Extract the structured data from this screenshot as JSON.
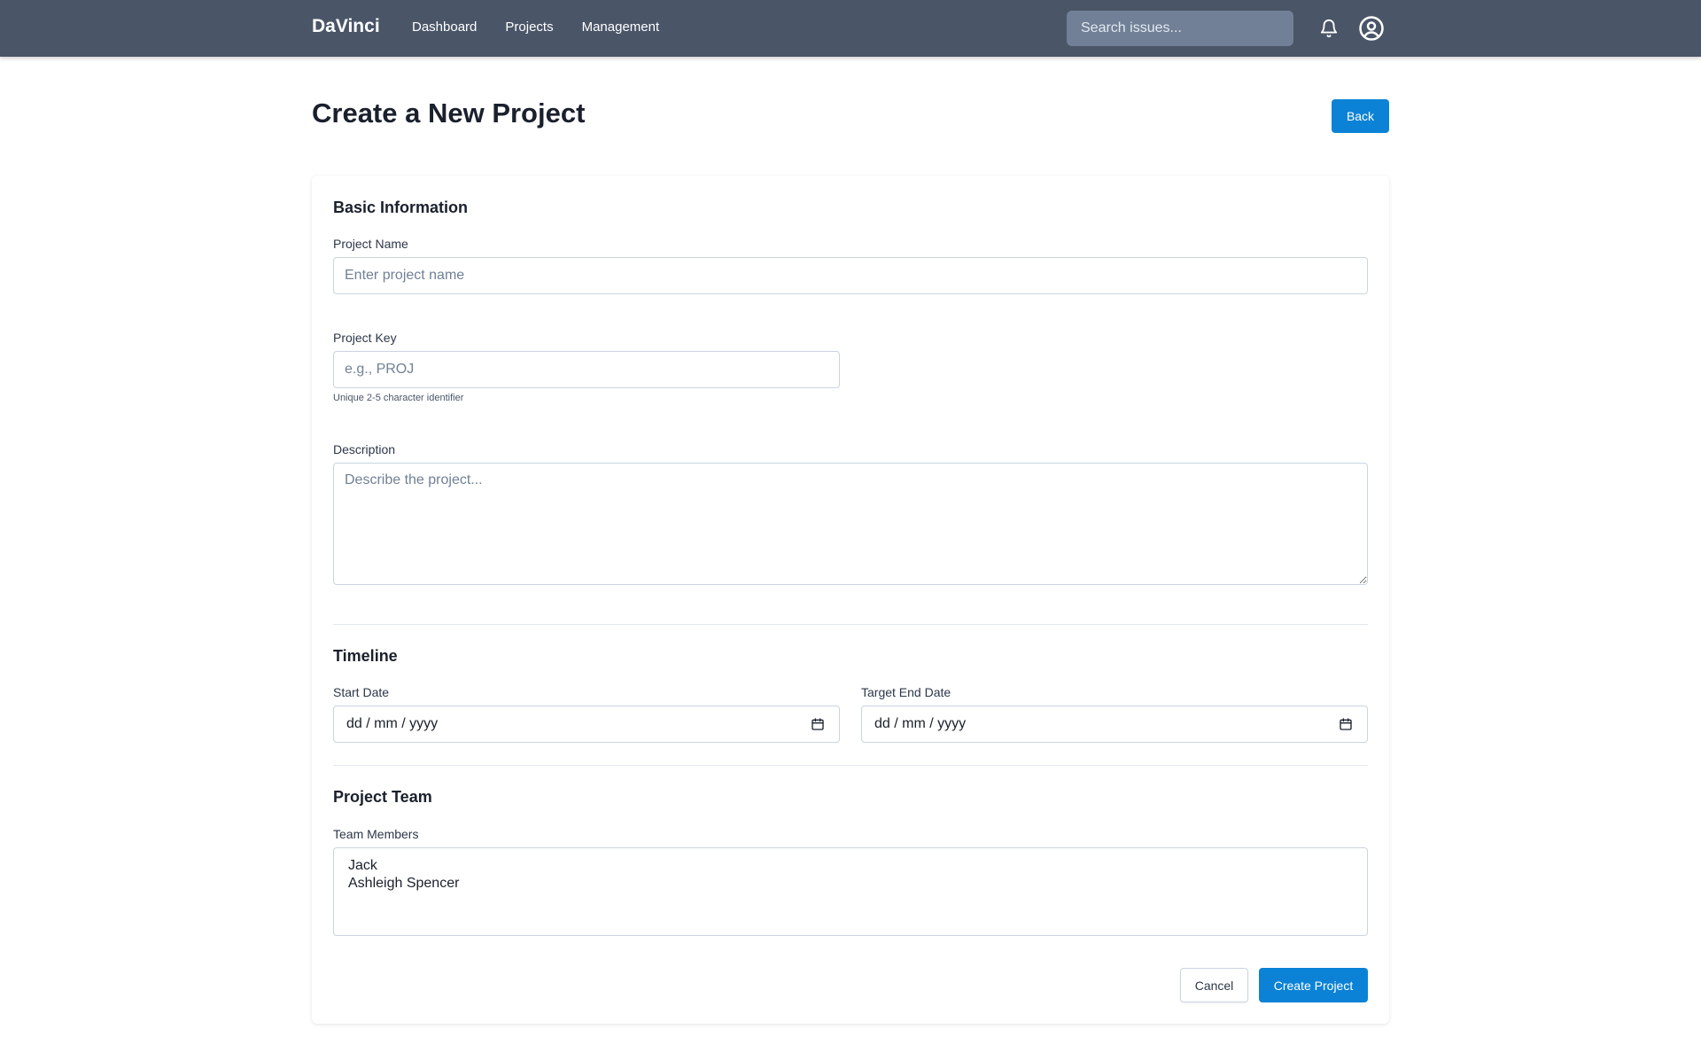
{
  "app": {
    "name": "DaVinci"
  },
  "nav": {
    "items": [
      "Dashboard",
      "Projects",
      "Management"
    ]
  },
  "search": {
    "placeholder": "Search issues..."
  },
  "header": {
    "notifications_icon": "bell-icon",
    "profile_icon": "user-circle-icon"
  },
  "page": {
    "title": "Create a New Project",
    "back_label": "Back"
  },
  "basic_info": {
    "title": "Basic Information",
    "project_name": {
      "label": "Project Name",
      "placeholder": "Enter project name",
      "value": ""
    },
    "project_key": {
      "label": "Project Key",
      "placeholder": "e.g., PROJ",
      "value": "",
      "hint": "Unique 2-5 character identifier"
    },
    "description": {
      "label": "Description",
      "placeholder": "Describe the project...",
      "value": ""
    }
  },
  "timeline": {
    "title": "Timeline",
    "start_date": {
      "label": "Start Date",
      "value": "dd / mm / yyyy"
    },
    "end_date": {
      "label": "Target End Date",
      "value": "dd / mm / yyyy"
    },
    "calendar_icon": "calendar-icon"
  },
  "team": {
    "title": "Project Team",
    "members_label": "Team Members",
    "options": [
      "Jack",
      "Ashleigh Spencer"
    ]
  },
  "actions": {
    "cancel_label": "Cancel",
    "create_label": "Create Project"
  },
  "colors": {
    "topbar": "#4a5568",
    "primary": "#0b82d6",
    "search_bg": "#718096"
  }
}
